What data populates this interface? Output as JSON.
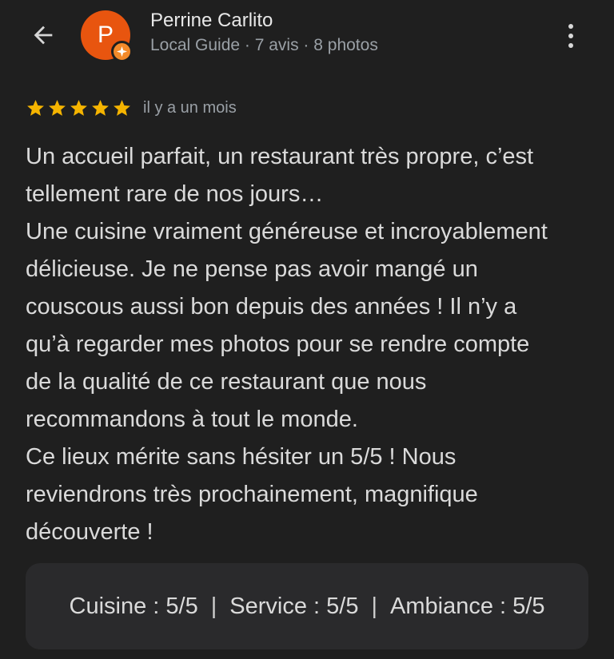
{
  "header": {
    "back_icon": "arrow-left-icon",
    "user": {
      "avatar_letter": "P",
      "avatar_color": "#e8550f",
      "badge_icon": "local-guide-star-icon",
      "badge_color": "#f48a2a",
      "name": "Perrine Carlito",
      "meta": "Local Guide · 7 avis · 8 photos"
    },
    "more_icon": "more-vert-icon"
  },
  "review": {
    "rating": 5,
    "rating_max": 5,
    "star_color": "#f5b400",
    "time_ago": "il y a un mois",
    "text_lines": [
      "Un accueil parfait, un restaurant très propre, c’est",
      "tellement rare de nos jours…",
      "Une cuisine vraiment généreuse et incroyablement",
      "délicieuse. Je ne pense pas avoir mangé un",
      "couscous aussi bon depuis des années ! Il n’y a",
      "qu’à regarder mes photos pour se rendre compte",
      "de la qualité de ce restaurant que nous",
      "recommandons à tout le monde.",
      "Ce lieux mérite sans hésiter un 5/5 ! Nous",
      "reviendrons très prochainement, magnifique",
      "découverte !"
    ]
  },
  "subratings": {
    "items": [
      "Cuisine : 5/5",
      "Service : 5/5",
      "Ambiance : 5/5"
    ],
    "separator": "|"
  }
}
